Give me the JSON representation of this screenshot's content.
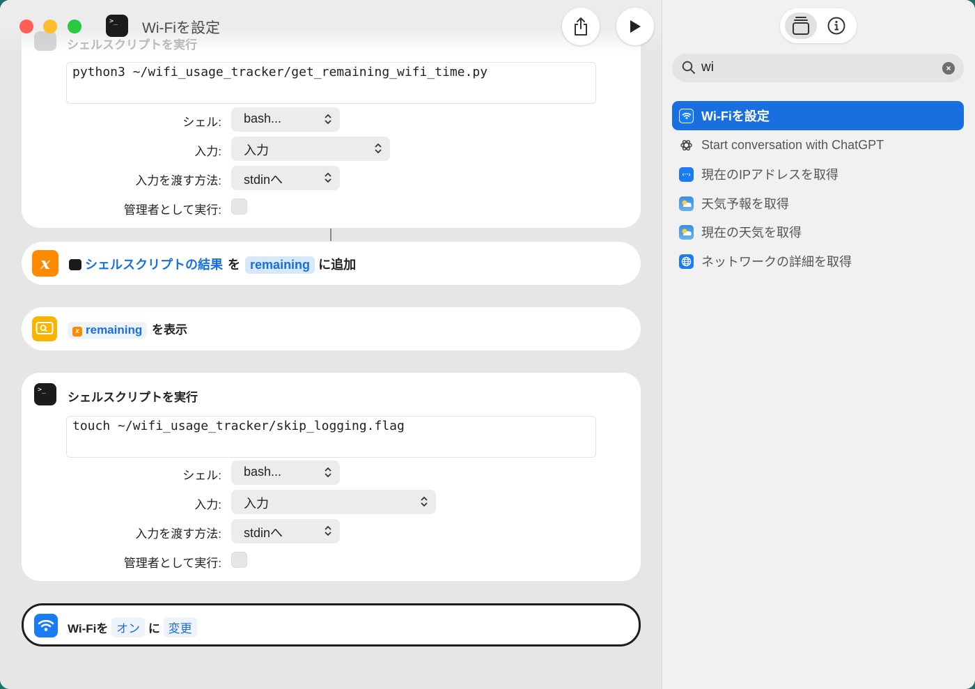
{
  "window": {
    "title": "Wi-Fiを設定"
  },
  "header": {
    "faded_action_title": "シェルスクリプトを実行"
  },
  "block1": {
    "script": "python3 ~/wifi_usage_tracker/get_remaining_wifi_time.py",
    "shell_label": "シェル:",
    "shell_value": "bash...",
    "input_label": "入力:",
    "input_value": "入力",
    "pass_label": "入力を渡す方法:",
    "pass_value": "stdinへ",
    "admin_label": "管理者として実行:"
  },
  "append_action": {
    "source_token": "シェルスクリプトの結果",
    "joiner": "を",
    "variable_token": "remaining",
    "suffix": "に追加"
  },
  "show_action": {
    "variable_token": "remaining",
    "suffix": "を表示"
  },
  "block2": {
    "title": "シェルスクリプトを実行",
    "script": "touch ~/wifi_usage_tracker/skip_logging.flag",
    "shell_label": "シェル:",
    "shell_value": "bash...",
    "input_label": "入力:",
    "input_value": "入力",
    "pass_label": "入力を渡す方法:",
    "pass_value": "stdinへ",
    "admin_label": "管理者として実行:"
  },
  "wifi_action": {
    "prefix": "Wi-Fiを",
    "state_token": "オン",
    "joiner": "に",
    "mode_token": "変更"
  },
  "sidebar": {
    "search_value": "wi",
    "results": [
      {
        "label": "Wi-Fiを設定",
        "icon": "wifi-icon",
        "selected": true
      },
      {
        "label": "Start conversation with ChatGPT",
        "icon": "chatgpt-icon",
        "selected": false
      },
      {
        "label": "現在のIPアドレスを取得",
        "icon": "ip-address-icon",
        "selected": false
      },
      {
        "label": "天気予報を取得",
        "icon": "weather-icon",
        "selected": false
      },
      {
        "label": "現在の天気を取得",
        "icon": "weather-icon",
        "selected": false
      },
      {
        "label": "ネットワークの詳細を取得",
        "icon": "globe-icon",
        "selected": false
      }
    ]
  },
  "colors": {
    "accent": "#1a6fe0",
    "variable_orange": "#ff8a00",
    "show_yellow": "#f7b500",
    "token_bg": "#e3effc"
  }
}
